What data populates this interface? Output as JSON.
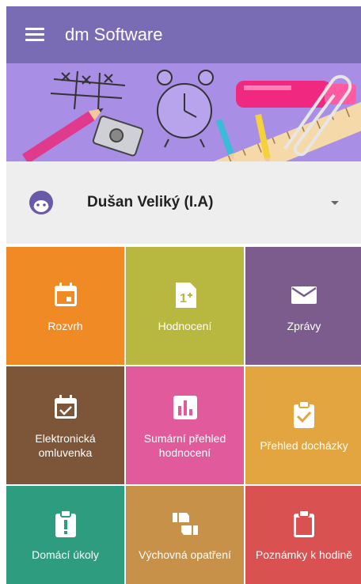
{
  "app": {
    "title": "dm Software"
  },
  "profile": {
    "name": "Dušan Veliký (I.A)"
  },
  "tiles": [
    {
      "label": "Rozvrh",
      "icon": "calendar-icon",
      "color": "#f08a24"
    },
    {
      "label": "Hodnocení",
      "icon": "grade-document-icon",
      "color": "#b8b73f"
    },
    {
      "label": "Zprávy",
      "icon": "envelope-icon",
      "color": "#7b5c8c"
    },
    {
      "label": "Elektronická omluvenka",
      "icon": "calendar-check-icon",
      "color": "#7d5538"
    },
    {
      "label": "Sumární přehled hodnocení",
      "icon": "bar-chart-icon",
      "color": "#e05a9c"
    },
    {
      "label": "Přehled docházky",
      "icon": "clipboard-check-icon",
      "color": "#e3a53f"
    },
    {
      "label": "Domácí úkoly",
      "icon": "clipboard-alert-icon",
      "color": "#2e9d7f"
    },
    {
      "label": "Výchovná opatření",
      "icon": "thumbs-icon",
      "color": "#c8914a"
    },
    {
      "label": "Poznámky k hodině",
      "icon": "clipboard-icon",
      "color": "#d95151"
    }
  ]
}
